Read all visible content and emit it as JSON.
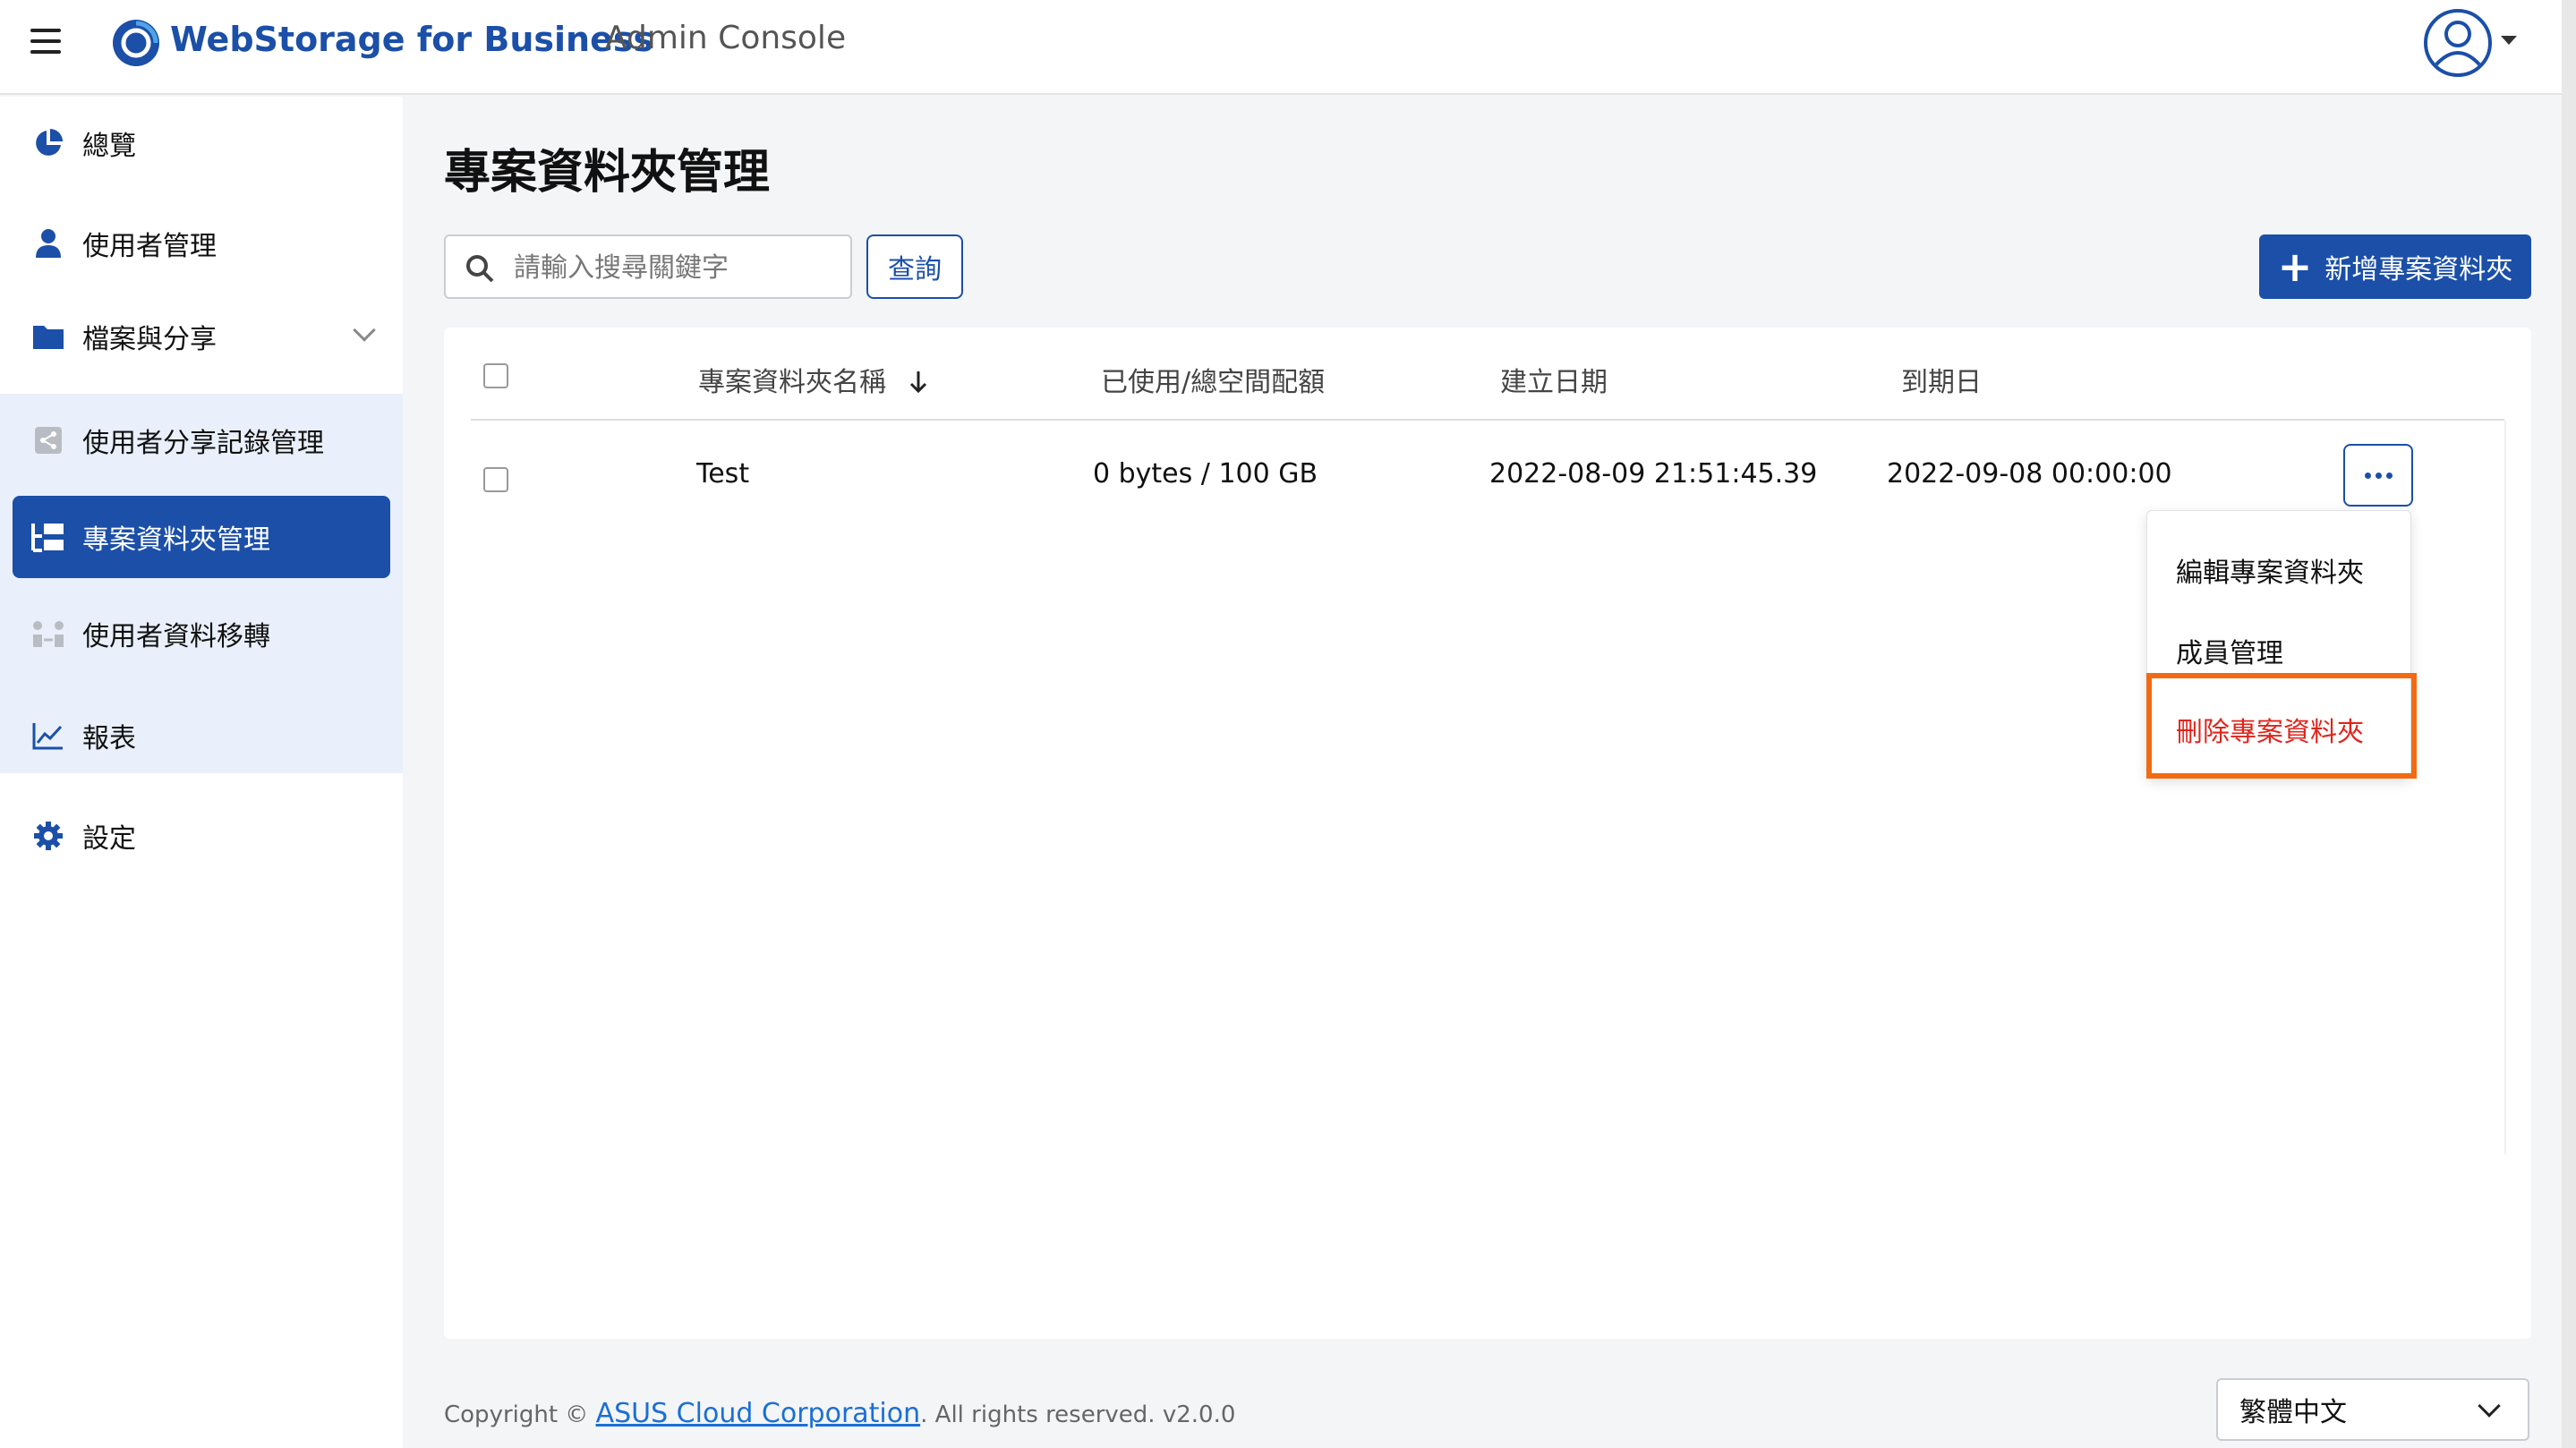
{
  "header": {
    "brand": "WebStorage for Business",
    "subtitle": "Admin Console"
  },
  "sidebar": {
    "items": [
      {
        "label": "總覽",
        "icon": "pie-chart-icon"
      },
      {
        "label": "使用者管理",
        "icon": "user-icon"
      },
      {
        "label": "檔案與分享",
        "icon": "folder-icon"
      },
      {
        "label": "使用者分享記錄管理",
        "icon": "share-log-icon"
      },
      {
        "label": "專案資料夾管理",
        "icon": "project-folder-icon"
      },
      {
        "label": "使用者資料移轉",
        "icon": "transfer-icon"
      },
      {
        "label": "報表",
        "icon": "line-chart-icon"
      },
      {
        "label": "設定",
        "icon": "gear-icon"
      }
    ]
  },
  "main": {
    "title": "專案資料夾管理",
    "search": {
      "placeholder": "請輸入搜尋關鍵字",
      "button": "查詢"
    },
    "add_button": "新增專案資料夾",
    "table": {
      "columns": [
        "專案資料夾名稱",
        "已使用/總空間配額",
        "建立日期",
        "到期日"
      ],
      "rows": [
        {
          "name": "Test",
          "usage": "0 bytes / 100 GB",
          "created": "2022-08-09 21:51:45.39",
          "expires": "2022-09-08 00:00:00"
        }
      ]
    },
    "row_menu": [
      "編輯專案資料夾",
      "成員管理",
      "刪除專案資料夾"
    ]
  },
  "footer": {
    "copyright_prefix": "Copyright © ",
    "company": "ASUS Cloud Corporation",
    "copyright_suffix": ". All rights reserved. v2.0.0",
    "language": "繁體中文"
  },
  "colors": {
    "primary": "#1b4fa8",
    "danger": "#e0241b",
    "highlight": "#f26a12"
  }
}
